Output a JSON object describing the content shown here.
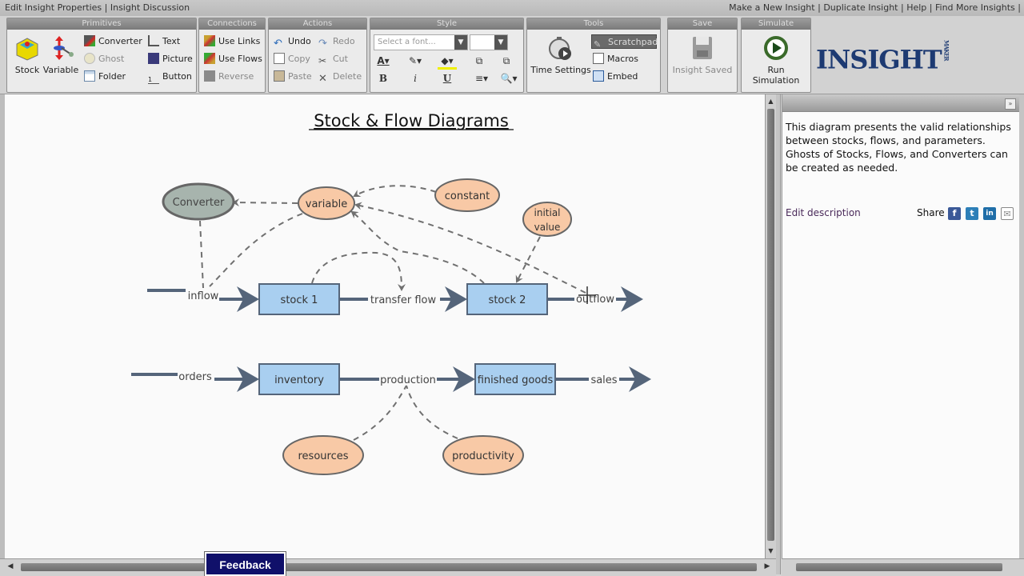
{
  "topbar": {
    "left_links": [
      "Edit Insight Properties",
      "Insight Discussion"
    ],
    "right_links": [
      "Make a New Insight",
      "Duplicate Insight",
      "Help",
      "Find More Insights"
    ]
  },
  "toolbar": {
    "groups": {
      "primitives": "Primitives",
      "connections": "Connections",
      "actions": "Actions",
      "style": "Style",
      "tools": "Tools",
      "save": "Save",
      "simulate": "Simulate"
    },
    "primitives": {
      "stock": "Stock",
      "variable": "Variable",
      "converter": "Converter",
      "ghost": "Ghost",
      "folder": "Folder",
      "text": "Text",
      "picture": "Picture",
      "button": "Button"
    },
    "connections": {
      "use_links": "Use Links",
      "use_flows": "Use Flows",
      "reverse": "Reverse"
    },
    "actions": {
      "undo": "Undo",
      "redo": "Redo",
      "copy": "Copy",
      "cut": "Cut",
      "paste": "Paste",
      "delete": "Delete"
    },
    "style": {
      "font_placeholder": "Select a font...",
      "bold": "B",
      "italic": "i",
      "underline": "U"
    },
    "tools": {
      "time_settings": "Time Settings",
      "scratchpad": "Scratchpad",
      "macros": "Macros",
      "embed": "Embed"
    },
    "save": {
      "status": "Insight Saved"
    },
    "simulate": {
      "run": "Run Simulation"
    },
    "logo": {
      "text": "INSIGHT",
      "sub": "MAKER"
    }
  },
  "diagram": {
    "title": "Stock & Flow Diagrams",
    "colors": {
      "stock_fill": "#a9cff0",
      "variable_fill": "#f8c9a6",
      "converter_fill": "#a7b4ad",
      "flow_line": "#55657a",
      "link_line": "#6a6a6a"
    },
    "stocks": [
      {
        "id": "stock1",
        "label": "stock 1"
      },
      {
        "id": "stock2",
        "label": "stock 2"
      },
      {
        "id": "inventory",
        "label": "inventory"
      },
      {
        "id": "finished",
        "label": "finished goods"
      }
    ],
    "variables": [
      {
        "id": "variable",
        "label": "variable"
      },
      {
        "id": "constant",
        "label": "constant"
      },
      {
        "id": "initial",
        "label": "initial value"
      },
      {
        "id": "resources",
        "label": "resources"
      },
      {
        "id": "productivity",
        "label": "productivity"
      }
    ],
    "converters": [
      {
        "id": "converter",
        "label": "Converter"
      }
    ],
    "flows": [
      {
        "id": "inflow",
        "label": "inflow"
      },
      {
        "id": "transfer",
        "label": "transfer flow"
      },
      {
        "id": "outflow",
        "label": "outflow"
      },
      {
        "id": "orders",
        "label": "orders"
      },
      {
        "id": "production",
        "label": "production"
      },
      {
        "id": "sales",
        "label": "sales"
      }
    ]
  },
  "panel": {
    "description": "This diagram presents the valid relationships between stocks, flows, and parameters. Ghosts of Stocks, Flows, and Converters can be created as needed.",
    "edit_label": "Edit description",
    "share_label": "Share",
    "share_icons": [
      "facebook-icon",
      "twitter-icon",
      "linkedin-icon",
      "email-icon"
    ]
  },
  "feedback": {
    "label": "Feedback"
  }
}
